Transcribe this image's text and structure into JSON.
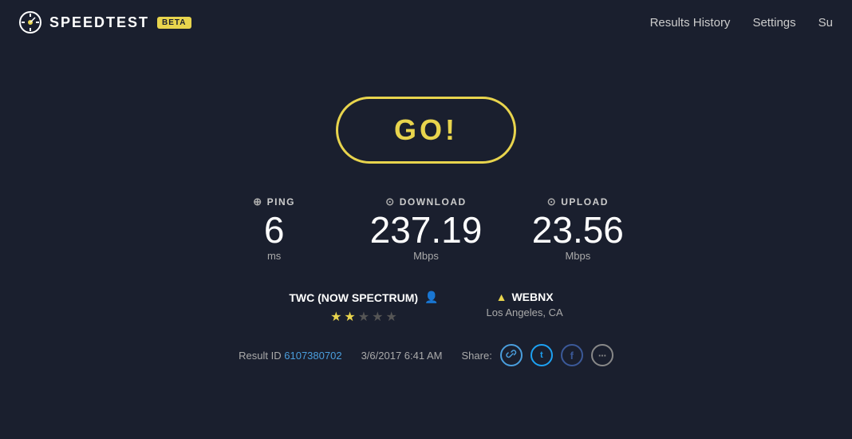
{
  "header": {
    "logo_text": "SPEEDTEST",
    "beta_label": "BETA",
    "nav": {
      "results_history": "Results History",
      "settings": "Settings",
      "support": "Su"
    }
  },
  "main": {
    "go_button_label": "GO!",
    "stats": [
      {
        "id": "ping",
        "icon": "⊕",
        "label": "PING",
        "value": "6",
        "unit": "ms"
      },
      {
        "id": "download",
        "icon": "⊙",
        "label": "DOWNLOAD",
        "value": "237.19",
        "unit": "Mbps"
      },
      {
        "id": "upload",
        "icon": "⊙",
        "label": "UPLOAD",
        "value": "23.56",
        "unit": "Mbps"
      }
    ],
    "isp": {
      "name": "TWC (NOW SPECTRUM)",
      "stars_filled": 2,
      "stars_total": 5
    },
    "server": {
      "name": "WEBNX",
      "location": "Los Angeles, CA"
    },
    "result": {
      "id_label": "Result ID",
      "id_value": "6107380702",
      "timestamp": "3/6/2017 6:41 AM",
      "share_label": "Share:"
    }
  }
}
